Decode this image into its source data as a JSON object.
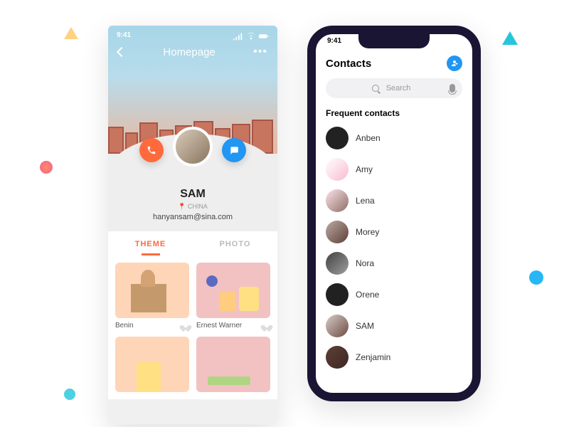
{
  "status_time": "9:41",
  "left": {
    "header_title": "Homepage",
    "profile": {
      "name": "SAM",
      "location": "CHINA",
      "email": "hanyansam@sina.com"
    },
    "tabs": {
      "theme": "THEME",
      "photo": "PHOTO"
    },
    "cards": [
      {
        "name": "Benin"
      },
      {
        "name": "Ernest Warner"
      }
    ]
  },
  "right": {
    "title": "Contacts",
    "search_placeholder": "Search",
    "section": "Frequent contacts",
    "contacts": [
      {
        "name": "Anben"
      },
      {
        "name": "Amy"
      },
      {
        "name": "Lena"
      },
      {
        "name": "Morey"
      },
      {
        "name": "Nora"
      },
      {
        "name": "Orene"
      },
      {
        "name": "SAM"
      },
      {
        "name": "Zenjamin"
      }
    ]
  }
}
